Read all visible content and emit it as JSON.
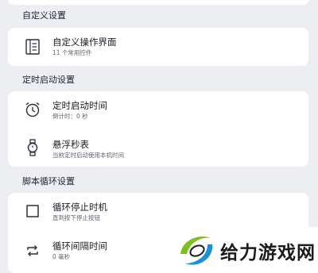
{
  "sections": [
    {
      "title": "自定义设置",
      "rows": [
        {
          "icon": "list-panel-icon",
          "title": "自定义操作界面",
          "subtitle": "11 个常用控件"
        }
      ]
    },
    {
      "title": "定时启动设置",
      "rows": [
        {
          "icon": "alarm-clock-icon",
          "title": "定时启动时间",
          "subtitle": "倒计时：0 秒"
        },
        {
          "icon": "watch-icon",
          "title": "悬浮秒表",
          "subtitle": "当前定时启动使用本机时间"
        }
      ]
    },
    {
      "title": "脚本循环设置",
      "rows": [
        {
          "icon": "square-icon",
          "title": "循环停止时机",
          "subtitle": "直到按下停止按钮"
        },
        {
          "icon": "repeat-icon",
          "title": "循环间隔时间",
          "subtitle": "0 毫秒"
        }
      ]
    }
  ],
  "watermark": {
    "text": "给力游戏网",
    "logo": "site-logo"
  },
  "colors": {
    "background": "#eceef2",
    "card": "#ffffff",
    "logo_green": "#7cc11f",
    "logo_blue": "#1d8fd6"
  }
}
